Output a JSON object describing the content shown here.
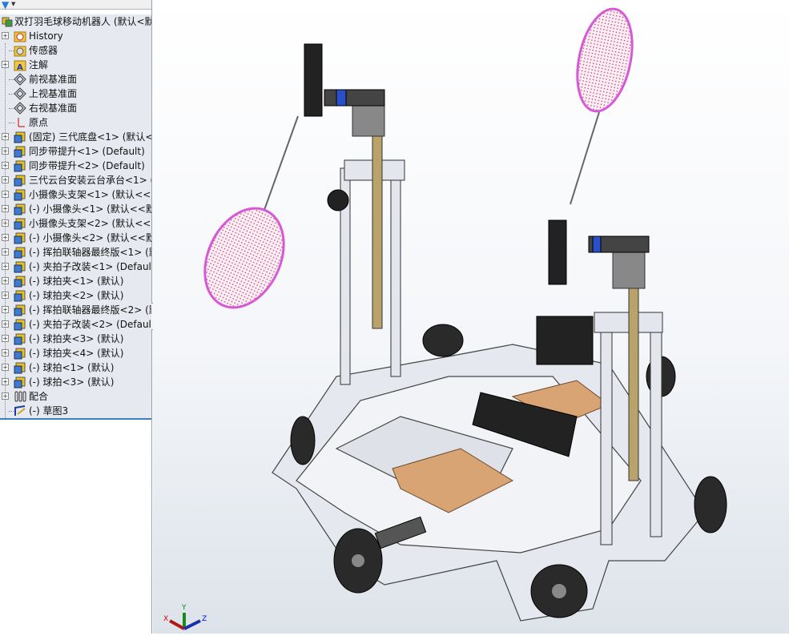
{
  "tree": {
    "root": "双打羽毛球移动机器人  (默认<默",
    "items": [
      {
        "label": "History",
        "icon": "history-folder-icon",
        "expand": true
      },
      {
        "label": "传感器",
        "icon": "sensor-folder-icon",
        "expand": false
      },
      {
        "label": "注解",
        "icon": "annotation-folder-icon",
        "expand": true
      },
      {
        "label": "前视基准面",
        "icon": "plane-icon",
        "expand": false
      },
      {
        "label": "上视基准面",
        "icon": "plane-icon",
        "expand": false
      },
      {
        "label": "右视基准面",
        "icon": "plane-icon",
        "expand": false
      },
      {
        "label": "原点",
        "icon": "origin-icon",
        "expand": false
      },
      {
        "label": "(固定) 三代底盘<1> (默认<默",
        "icon": "subassembly-icon",
        "expand": true
      },
      {
        "label": "同步带提升<1> (Default)",
        "icon": "subassembly-icon",
        "expand": true
      },
      {
        "label": "同步带提升<2> (Default)",
        "icon": "subassembly-icon",
        "expand": true
      },
      {
        "label": "三代云台安装云台承台<1> (",
        "icon": "subassembly-icon",
        "expand": true
      },
      {
        "label": "小摄像头支架<1> (默认<<默",
        "icon": "subassembly-icon",
        "expand": true
      },
      {
        "label": "(-) 小摄像头<1> (默认<<默",
        "icon": "subassembly-icon",
        "expand": true
      },
      {
        "label": "小摄像头支架<2> (默认<<默",
        "icon": "subassembly-icon",
        "expand": true
      },
      {
        "label": "(-) 小摄像头<2> (默认<<默",
        "icon": "subassembly-icon",
        "expand": true
      },
      {
        "label": "(-) 挥拍联轴器最终版<1> (默",
        "icon": "subassembly-icon",
        "expand": true
      },
      {
        "label": "(-) 夹拍子改装<1> (Default)",
        "icon": "subassembly-icon",
        "expand": true
      },
      {
        "label": "(-) 球拍夹<1> (默认)",
        "icon": "subassembly-icon",
        "expand": true
      },
      {
        "label": "(-) 球拍夹<2> (默认)",
        "icon": "subassembly-icon",
        "expand": true
      },
      {
        "label": "(-) 挥拍联轴器最终版<2> (默",
        "icon": "subassembly-icon",
        "expand": true
      },
      {
        "label": "(-) 夹拍子改装<2> (Default)",
        "icon": "subassembly-icon",
        "expand": true
      },
      {
        "label": "(-) 球拍夹<3> (默认)",
        "icon": "subassembly-icon",
        "expand": true
      },
      {
        "label": "(-) 球拍夹<4> (默认)",
        "icon": "subassembly-icon",
        "expand": true
      },
      {
        "label": "(-) 球拍<1> (默认)",
        "icon": "subassembly-icon",
        "expand": true
      },
      {
        "label": "(-) 球拍<3> (默认)",
        "icon": "subassembly-icon",
        "expand": true
      },
      {
        "label": "配合",
        "icon": "mates-icon",
        "expand": true
      },
      {
        "label": "(-) 草图3",
        "icon": "sketch-icon",
        "expand": false
      }
    ]
  },
  "triad": {
    "x": "X",
    "y": "Y",
    "z": "Z"
  },
  "colors": {
    "panel": "#e6eaf0",
    "frame": "#e4e6ee",
    "racket": "#d65ad6",
    "board": "#d9a473",
    "wheel": "#2a2a2a"
  }
}
